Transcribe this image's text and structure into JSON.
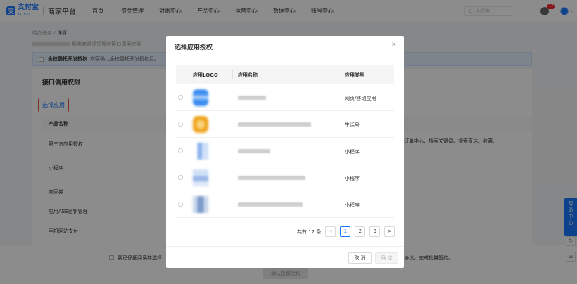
{
  "header": {
    "logo_text": "支付宝",
    "logo_sub": "ALIPAY",
    "platform": "商家平台",
    "nav": [
      "首页",
      "资金管理",
      "对账中心",
      "产品中心",
      "运营中心",
      "数据中心",
      "账号中心"
    ],
    "search_placeholder": "小程序",
    "notification_count": "17"
  },
  "page": {
    "breadcrumb_parent": "待办任务",
    "breadcrumb_sep": "/",
    "breadcrumb_current": "详情",
    "sub_desc": "服务商邀请您授权接口调用权限",
    "notice_strong": "全权委托开发授权",
    "notice_text": "商家确认全权委托开发授权后。",
    "card_title": "接口调用权限",
    "select_app": "选择应用",
    "product_header": "产品名称",
    "products": [
      "第三方应用授权",
      "小程序",
      "商家券",
      "应用AES密钥管理",
      "手机网站支付"
    ],
    "behind_right_text": "订单中心、搜索关键词、搜索直达、收藏、",
    "footer_agree_left": "我已仔细阅读并选择",
    "footer_agree_right": "协议，完成批量签约。",
    "footer_confirm": "确认批量授权",
    "help_label": "帮助中心"
  },
  "modal": {
    "title": "选择应用授权",
    "columns": {
      "logo": "应用LOGO",
      "name": "应用名称",
      "type": "应用类型"
    },
    "rows": [
      {
        "type": "网页/移动应用",
        "logo_color": "#3d8ef0"
      },
      {
        "type": "生活号",
        "logo_color": "#f0a623"
      },
      {
        "type": "小程序",
        "logo_color": "#8db4ee"
      },
      {
        "type": "小程序",
        "logo_color": "#9ab8e8"
      },
      {
        "type": "小程序",
        "logo_color": "#7e9cc8"
      }
    ],
    "pagination": {
      "total_label": "共有 12 条",
      "prev": "<",
      "pages": [
        "1",
        "2",
        "3"
      ],
      "current": "1",
      "next": ">"
    },
    "cancel_label": "取 消",
    "ok_label": "确 定"
  }
}
